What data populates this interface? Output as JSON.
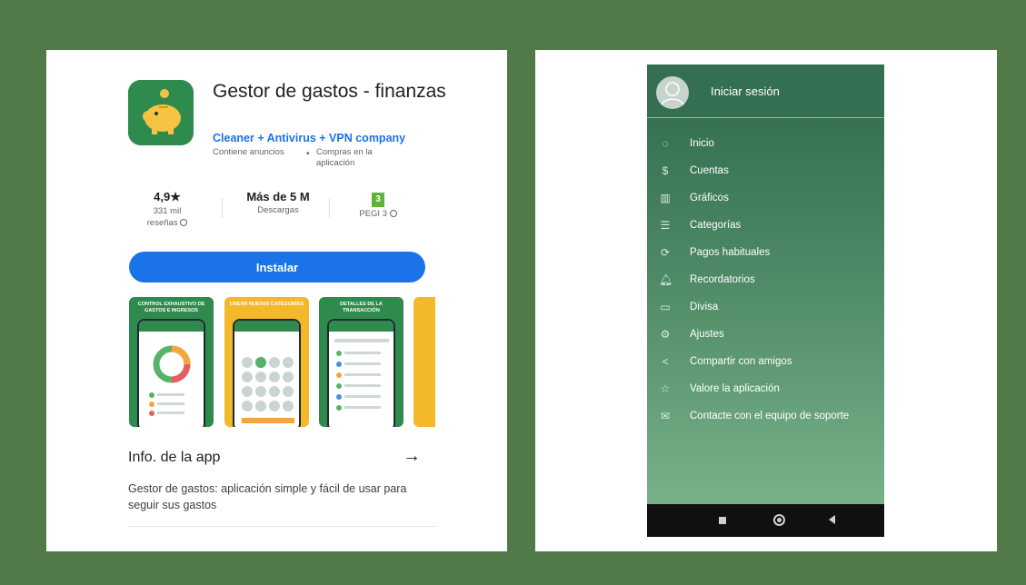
{
  "colors": {
    "background": "#527a48",
    "brand_green": "#2f8a4e",
    "install_blue": "#1a73e8",
    "pegi_green": "#5fb336"
  },
  "listing": {
    "app_icon": "piggy-bank-icon",
    "title": "Gestor de gastos - finanzas",
    "developer": "Cleaner + Antivirus + VPN company",
    "tag_ads": "Contiene anuncios",
    "tag_separator": "•",
    "tag_iap": "Compras en la aplicación",
    "stats": {
      "rating": "4,9★",
      "reviews_line1": "331 mil",
      "reviews_line2": "reseñas",
      "downloads": "Más de 5 M",
      "downloads_label": "Descargas",
      "pegi_badge": "3",
      "pegi_label": "PEGI 3"
    },
    "install_label": "Instalar",
    "screenshots": [
      {
        "caption": "CONTROL EXHAUSTIVO DE GASTOS E INGRESOS",
        "color": "#2f8a4e"
      },
      {
        "caption": "CREAR NUEVAS CATEGORÍAS",
        "color": "#f4b82b"
      },
      {
        "caption": "DETALLES DE LA TRANSACCIÓN",
        "color": "#2f8a4e"
      }
    ],
    "info_title": "Info. de la app",
    "info_arrow": "→",
    "info_description": "Gestor de gastos: aplicación simple y fácil de usar para seguir sus gastos"
  },
  "drawer": {
    "login_label": "Iniciar sesión",
    "items": [
      {
        "label": "Inicio",
        "icon": "home-icon",
        "glyph": "◌"
      },
      {
        "label": "Cuentas",
        "icon": "money-bag-icon",
        "glyph": "$"
      },
      {
        "label": "Gráficos",
        "icon": "bar-chart-icon",
        "glyph": "▥"
      },
      {
        "label": "Categorías",
        "icon": "list-icon",
        "glyph": "☰"
      },
      {
        "label": "Pagos habituales",
        "icon": "recurring-payment-icon",
        "glyph": "⟳"
      },
      {
        "label": "Recordatorios",
        "icon": "bell-icon",
        "glyph": "🔔︎"
      },
      {
        "label": "Divisa",
        "icon": "currency-icon",
        "glyph": "▭"
      },
      {
        "label": "Ajustes",
        "icon": "gear-icon",
        "glyph": "⚙"
      },
      {
        "label": "Compartir con amigos",
        "icon": "share-icon",
        "glyph": "<"
      },
      {
        "label": "Valore la aplicación",
        "icon": "star-icon",
        "glyph": "☆"
      },
      {
        "label": "Contacte con el equipo de soporte",
        "icon": "mail-icon",
        "glyph": "✉"
      }
    ]
  }
}
